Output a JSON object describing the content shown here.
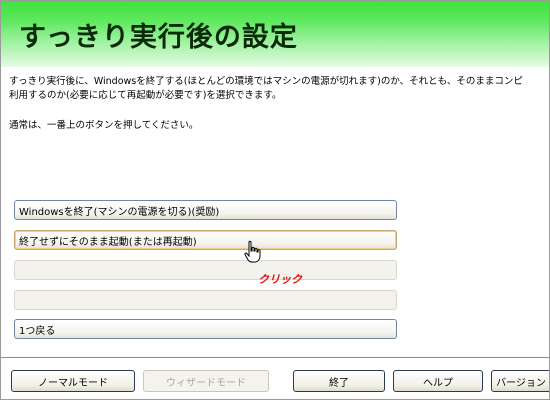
{
  "title": "すっきり実行後の設定",
  "description": {
    "line1": "すっきり実行後に、Windowsを終了する(ほとんどの環境ではマシンの電源が切れます)のか、それとも、そのままコンピ",
    "line2": "利用するのか(必要に応じて再起動が必要です)を選択できます。"
  },
  "note": "通常は、一番上のボタンを押してください。",
  "options": [
    {
      "label": "Windowsを終了(マシンの電源を切る)(奨励)"
    },
    {
      "label": "終了せずにそのまま起動(または再起動)"
    },
    {
      "label": ""
    },
    {
      "label": ""
    },
    {
      "label": "1つ戻る"
    }
  ],
  "annotation": "クリック",
  "footer": {
    "normal_mode": "ノーマルモード",
    "wizard_mode": "ウィザードモード",
    "exit": "終了",
    "help": "ヘルプ",
    "version": "バージョン"
  },
  "colors": {
    "header_green": "#3ee23e",
    "annotation_red": "#e01010"
  },
  "icons": {
    "cursor": "hand-pointer-icon"
  }
}
